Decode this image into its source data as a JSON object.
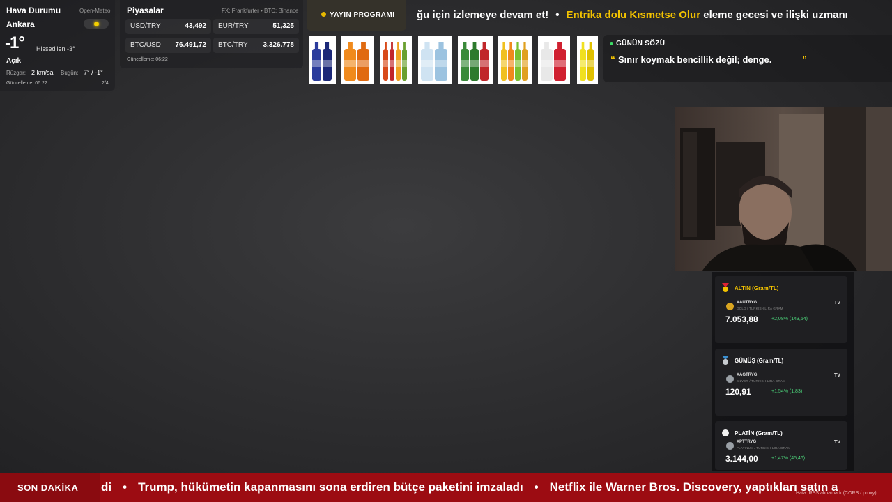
{
  "weather": {
    "title": "Hava Durumu",
    "source": "Open-Meteo",
    "city": "Ankara",
    "temperature": "-1°",
    "feels_like": "Hissedilen -3°",
    "condition": "Açık",
    "wind_label": "Rüzgar:",
    "wind_value": "2 km/sa",
    "today_label": "Bugün:",
    "today_value": "7° / -1°",
    "updated": "Güncelleme: 06:22",
    "page": "2/4",
    "icon": "sun-icon",
    "icon_color": "#f5d000"
  },
  "markets": {
    "title": "Piyasalar",
    "source": "FX: Frankfurter • BTC: Binance",
    "items": [
      {
        "pair": "USD/TRY",
        "value": "43,492"
      },
      {
        "pair": "EUR/TRY",
        "value": "51,325"
      },
      {
        "pair": "BTC/USD",
        "value": "76.491,72"
      },
      {
        "pair": "BTC/TRY",
        "value": "3.326.778"
      }
    ],
    "updated": "Güncelleme: 06:22"
  },
  "schedule": {
    "label": "YAYIN PROGRAMI",
    "ticker_white_1": "ğu için izlemeye devam et!",
    "ticker_highlight": "Entrika dolu Kısmetse Olur",
    "ticker_white_2": "eleme gecesi ve ilişki uzmanı",
    "accent_color": "#f2c200"
  },
  "products": [
    {
      "name": "blue-bottle-product",
      "colors": [
        "#2a3b9c",
        "#1b2878"
      ]
    },
    {
      "name": "orange-soda-product",
      "colors": [
        "#f08a1c",
        "#e06a10"
      ]
    },
    {
      "name": "soda-multipack-product",
      "colors": [
        "#d84a1a",
        "#c0262a",
        "#f0a020",
        "#6aa030"
      ]
    },
    {
      "name": "water-bottle-product",
      "colors": [
        "#cfe3f2",
        "#9cc3e0"
      ]
    },
    {
      "name": "green-bottle-product",
      "colors": [
        "#3a8a3a",
        "#2d7a2d",
        "#c0262a"
      ]
    },
    {
      "name": "juice-multipack-product",
      "colors": [
        "#f0c020",
        "#f08a1c",
        "#7ac030",
        "#e0a020"
      ]
    },
    {
      "name": "red-label-bottle-product",
      "colors": [
        "#e8e8e8",
        "#d02030"
      ]
    },
    {
      "name": "lemon-bottle-product",
      "colors": [
        "#f0e020",
        "#e0c000"
      ]
    }
  ],
  "quote": {
    "label": "GÜNÜN SÖZÜ",
    "open_mark": "“",
    "text": "Sınır koymak bencillik değil; denge.",
    "close_mark": "”"
  },
  "metals": [
    {
      "header": "ALTIN (Gram/TL)",
      "header_color": "#f2c200",
      "icon": "gold-medal-icon",
      "symbol": "XAUTRYG",
      "subtitle": "GOLD / TURKISH LIRA GRAM",
      "logo": "TV",
      "price": "7.053,88",
      "change": "+2,08% (143,54)",
      "symbol_color": "#d9a520"
    },
    {
      "header": "GÜMÜŞ (Gram/TL)",
      "header_color": "#ffffff",
      "icon": "silver-medal-icon",
      "symbol": "XAGTRYG",
      "subtitle": "SILVER / TURKISH LIRA GRAM",
      "logo": "TV",
      "price": "120,91",
      "change": "+1,54% (1,83)",
      "symbol_color": "#9aa0a6"
    },
    {
      "header": "PLATİN (Gram/TL)",
      "header_color": "#ffffff",
      "icon": "platinum-circle-icon",
      "symbol": "XPTTRYG",
      "subtitle": "PLATINUM / TURKISH LIRA GRAM",
      "logo": "TV",
      "price": "3.144,00",
      "change": "+1,47% (45,46)",
      "symbol_color": "#9aa0a6"
    }
  ],
  "news": {
    "label": "SON DAKİKA",
    "item_0": "di",
    "item_1": "Trump, hükümetin kapanmasını sona erdiren bütçe paketini imzaladı",
    "item_2": "Netflix ile Warner Bros. Discovery, yaptıkları satın a",
    "bullet": "•",
    "error": "Hata: RSS alınamadı (CORS / proxy).",
    "color": "#9c0c12"
  }
}
